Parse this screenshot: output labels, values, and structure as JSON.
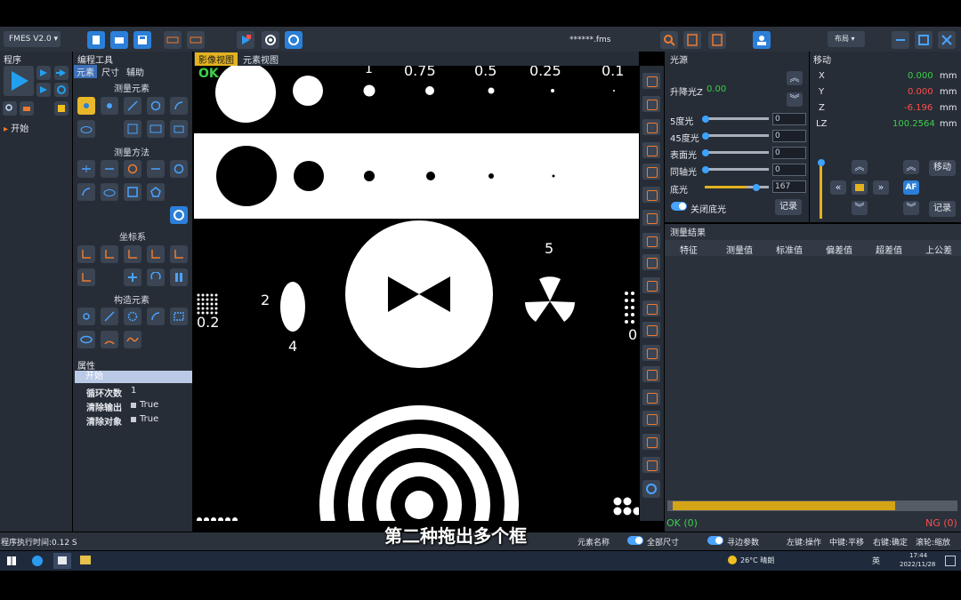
{
  "toolbar": {
    "app_label": "FMES V2.0",
    "filename": "******.fms",
    "layout_label": "布局"
  },
  "left": {
    "program_title": "程序",
    "start_label": "开始"
  },
  "tools": {
    "title": "编程工具",
    "tabs": [
      "元素",
      "尺寸",
      "辅助"
    ],
    "sections": {
      "measure_elements": "测量元素",
      "measure_methods": "测量方法",
      "coordinate": "坐标系",
      "construct": "构造元素"
    }
  },
  "properties": {
    "title": "属性",
    "selected": "开始",
    "rows": [
      {
        "key": "循环次数",
        "value": "1"
      },
      {
        "key": "清除输出",
        "value": "True"
      },
      {
        "key": "清除对象",
        "value": "True"
      }
    ]
  },
  "view": {
    "tabs": [
      "影像视图",
      "元素视图"
    ],
    "ok_label": "OK",
    "labels": {
      "top1": "1",
      "top075": "0.75",
      "top05": "0.5",
      "top025": "0.25",
      "top01": "0.1",
      "n2": "2",
      "n4": "4",
      "n5": "5",
      "left02": "0.2",
      "right0": "0"
    }
  },
  "light": {
    "title": "光源",
    "lift_label": "升降光Z",
    "lift_value": "0.00",
    "rows": [
      {
        "label": "5度光",
        "value": "0",
        "level": 0
      },
      {
        "label": "45度光",
        "value": "0",
        "level": 0
      },
      {
        "label": "表面光",
        "value": "0",
        "level": 0
      },
      {
        "label": "同轴光",
        "value": "0",
        "level": 0
      },
      {
        "label": "底光",
        "value": "167",
        "level": 0.65
      }
    ],
    "close_bottom_light": "关闭底光",
    "record_button": "记录"
  },
  "move": {
    "title": "移动",
    "coords": [
      {
        "axis": "X",
        "value": "0.000",
        "unit": "mm"
      },
      {
        "axis": "Y",
        "value": "0.000",
        "unit": "mm"
      },
      {
        "axis": "Z",
        "value": "-6.196",
        "unit": "mm"
      },
      {
        "axis": "LZ",
        "value": "100.2564",
        "unit": "mm"
      }
    ],
    "af_label": "AF",
    "move_button": "移动",
    "record_button": "记录"
  },
  "results": {
    "title": "测量结果",
    "columns": [
      "特征",
      "测量值",
      "标准值",
      "偏差值",
      "超差值",
      "上公差"
    ],
    "ok_count": "OK (0)",
    "ng_count": "NG (0)"
  },
  "statusbar": {
    "exec_time": "程序执行时间:0.12 S",
    "element_name": "元素名称",
    "all_dims": "全部尺寸",
    "edge_params": "寻边参数",
    "hints": [
      "左键:操作",
      "中键:平移",
      "右键:确定",
      "滚轮:缩放"
    ]
  },
  "subtitle": "第二种拖出多个框",
  "taskbar": {
    "weather": "26°C 晴朗",
    "time": "17:44",
    "date": "2022/11/28",
    "ime": "英"
  },
  "colors": {
    "accent": "#2b7fd8",
    "ok": "#3ccf4a",
    "ng": "#ff4d4d",
    "warning": "#e3b21f",
    "coord_green": "#3ccf4a",
    "coord_red": "#ff4d4d"
  }
}
